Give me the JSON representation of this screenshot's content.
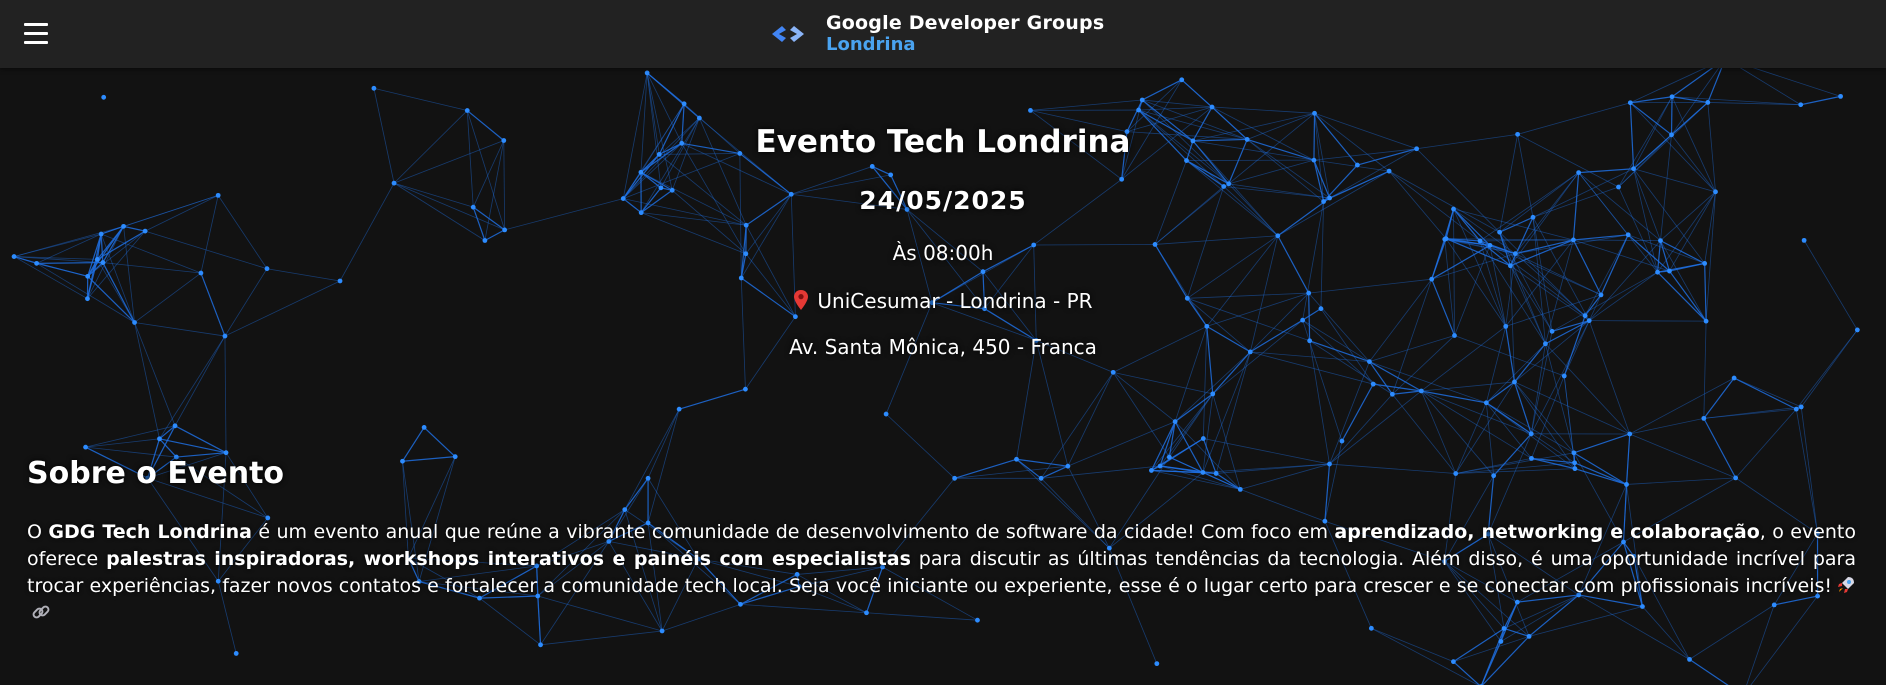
{
  "header": {
    "menu_icon": "hamburger-menu-icon",
    "logo_icon": "gdg-brackets-logo-icon",
    "brand_title": "Google Developer Groups",
    "brand_subtitle": "Londrina"
  },
  "event": {
    "title": "Evento Tech Londrina",
    "date": "24/05/2025",
    "time": "Às 08:00h",
    "location_icon": "map-pin-icon",
    "location": "UniCesumar - Londrina - PR",
    "address": "Av. Santa Mônica, 450 - Franca"
  },
  "about": {
    "heading": "Sobre o Evento",
    "p1_a": "O ",
    "p1_b": "GDG Tech Londrina",
    "p1_c": " é um evento anual que reúne a vibrante comunidade de desenvolvimento de software da cidade! Com foco em ",
    "p1_d": "aprendizado, networking e colaboração",
    "p1_e": ", o evento oferece ",
    "p1_f": "palestras inspiradoras, workshops interativos e painéis com especialistas",
    "p1_g": " para discutir as últimas tendências da tecnologia. Além disso, é uma oportunidade incrível para trocar experiências, fazer novos contatos e fortalecer a comunidade tech local. Seja você iniciante ou experiente, esse é o lugar certo para crescer e se conectar com profissionais incríveis!",
    "emoji_1": "rocket-icon",
    "emoji_2": "link-icon"
  },
  "colors": {
    "background": "#121212",
    "topbar": "#222222",
    "accent": "#4aa3f0",
    "network_line": "#1f6fe0",
    "network_node": "#2d8cff"
  }
}
